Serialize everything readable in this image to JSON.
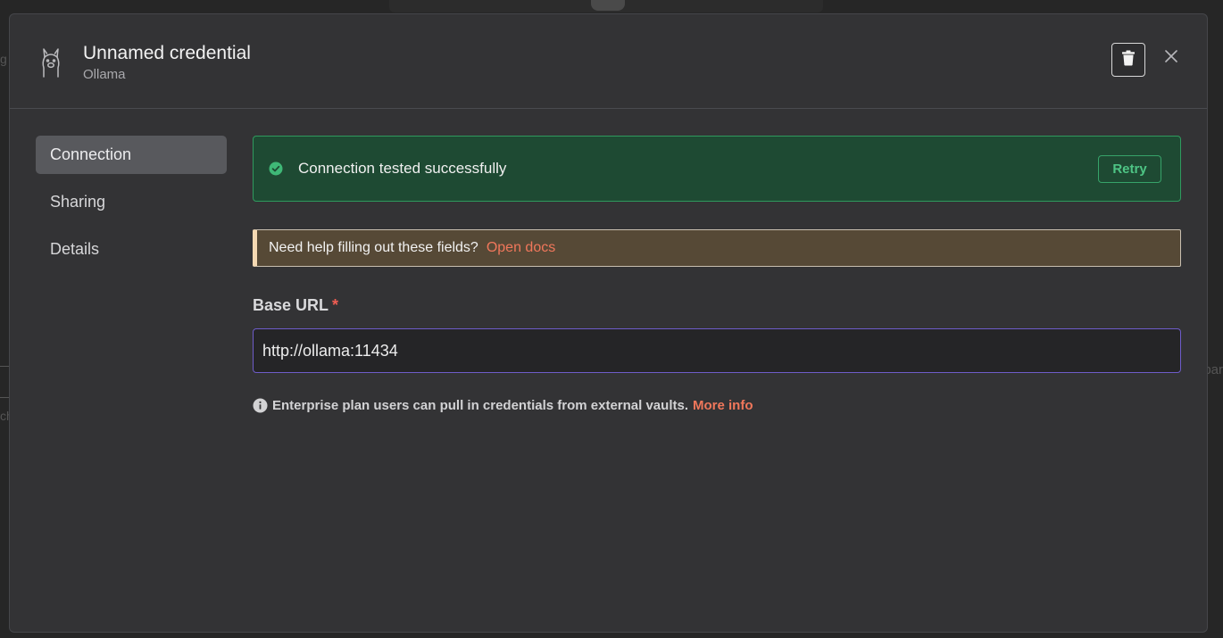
{
  "modal": {
    "title": "Unnamed credential",
    "subtitle": "Ollama"
  },
  "sidebar": {
    "items": [
      {
        "label": "Connection",
        "active": true
      },
      {
        "label": "Sharing",
        "active": false
      },
      {
        "label": "Details",
        "active": false
      }
    ]
  },
  "connection": {
    "status_message": "Connection tested successfully",
    "retry_label": "Retry",
    "docs_prompt": "Need help filling out these fields?",
    "docs_link": "Open docs",
    "base_url_label": "Base URL",
    "required_marker": "*",
    "base_url_value": "http://ollama:11434",
    "info_text": "Enterprise plan users can pull in credentials from external vaults.",
    "info_link": "More info"
  },
  "background": {
    "left_fragments": [
      "g",
      "ch"
    ],
    "right_fragment": "bar"
  },
  "icons": {
    "credential": "llama-icon",
    "delete": "trash-icon",
    "close": "close-icon",
    "status": "check-circle-icon",
    "info": "info-icon"
  },
  "colors": {
    "success_bg": "#1e4a33",
    "success_accent": "#2f9a5e",
    "link": "#f0775b",
    "input_focus": "#6e5cc9",
    "required": "#f05d53"
  }
}
